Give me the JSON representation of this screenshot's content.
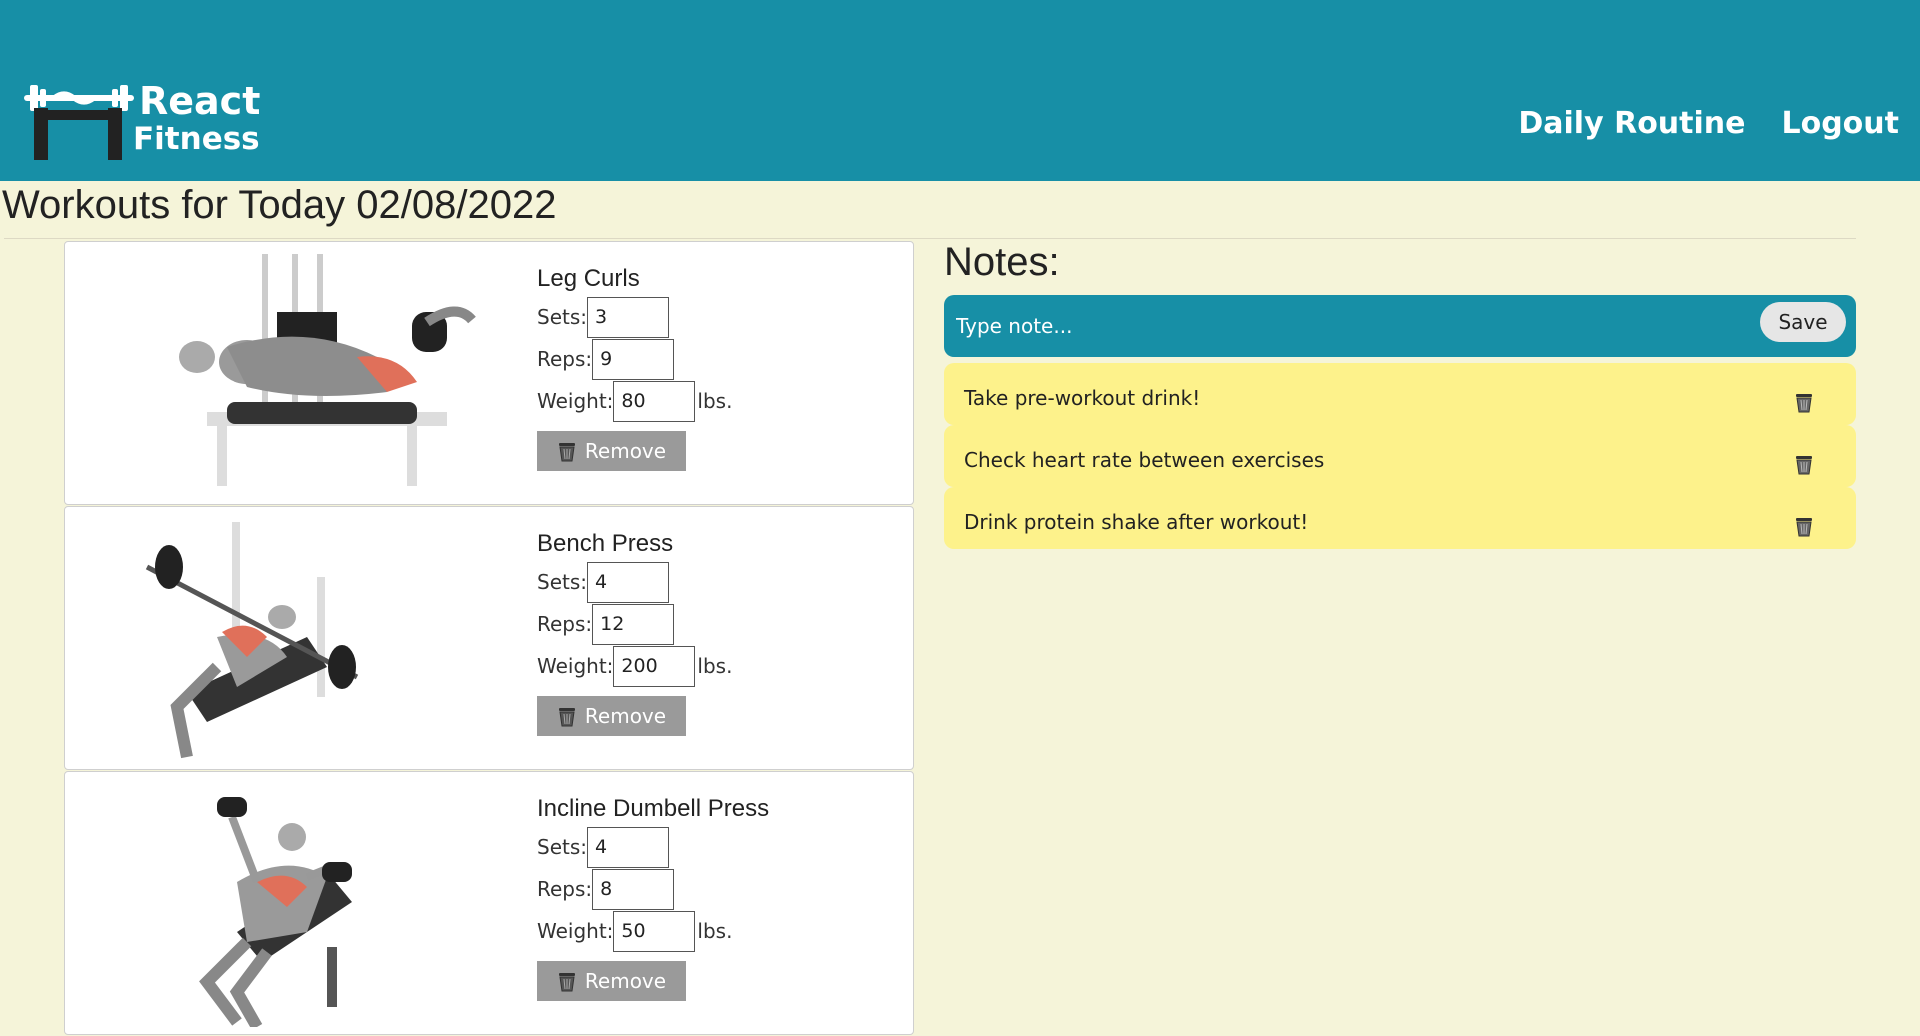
{
  "header": {
    "logo_line1": "React",
    "logo_line2": "Fitness",
    "nav": {
      "daily_routine": "Daily Routine",
      "logout": "Logout"
    },
    "bg_color": "#178fa6"
  },
  "page_title": "Workouts for Today 02/08/2022",
  "labels": {
    "sets": "Sets:",
    "reps": "Reps:",
    "weight": "Weight:",
    "unit": "lbs.",
    "remove": "Remove"
  },
  "workouts": [
    {
      "name": "Leg Curls",
      "sets": "3",
      "reps": "9",
      "weight": "80"
    },
    {
      "name": "Bench Press",
      "sets": "4",
      "reps": "12",
      "weight": "200"
    },
    {
      "name": "Incline Dumbell Press",
      "sets": "4",
      "reps": "8",
      "weight": "50"
    }
  ],
  "notes": {
    "title": "Notes:",
    "placeholder": "Type note...",
    "save_label": "Save",
    "items": [
      "Take pre-workout drink!",
      "Check heart rate between exercises",
      "Drink protein shake after workout!"
    ],
    "note_color": "#fdf28b"
  },
  "icons": {
    "remove": "trash-icon",
    "note_delete": "trash-icon"
  }
}
